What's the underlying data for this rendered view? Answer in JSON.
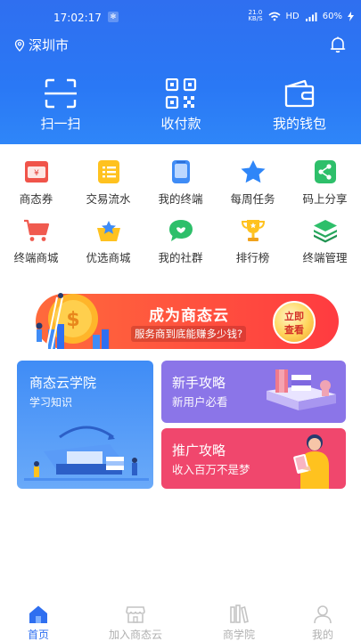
{
  "status_bar": {
    "time": "17:02:17",
    "speed_value": "21.0",
    "speed_unit": "KB/S",
    "network": "HD",
    "battery": "60%"
  },
  "header": {
    "city": "深圳市",
    "quick_actions": [
      {
        "label": "扫一扫",
        "icon": "scan-icon"
      },
      {
        "label": "收付款",
        "icon": "qrcode-icon"
      },
      {
        "label": "我的钱包",
        "icon": "wallet-icon"
      }
    ]
  },
  "features": [
    {
      "label": "商态券",
      "icon": "coupon-icon"
    },
    {
      "label": "交易流水",
      "icon": "list-icon"
    },
    {
      "label": "我的终端",
      "icon": "terminal-icon"
    },
    {
      "label": "每周任务",
      "icon": "star-icon"
    },
    {
      "label": "码上分享",
      "icon": "share-icon"
    },
    {
      "label": "终端商城",
      "icon": "cart-icon"
    },
    {
      "label": "优选商城",
      "icon": "basket-star-icon"
    },
    {
      "label": "我的社群",
      "icon": "chat-icon"
    },
    {
      "label": "排行榜",
      "icon": "trophy-icon"
    },
    {
      "label": "终端管理",
      "icon": "layers-icon"
    }
  ],
  "banner": {
    "title": "成为商态云",
    "subtitle": "服务商到底能赚多少钱?",
    "cta_line1": "立即",
    "cta_line2": "查看"
  },
  "cards": {
    "academy": {
      "title": "商态云学院",
      "subtitle": "学习知识"
    },
    "guide": {
      "title": "新手攻略",
      "subtitle": "新用户必看"
    },
    "promo": {
      "title": "推广攻略",
      "subtitle": "收入百万不是梦"
    }
  },
  "bottom_nav": [
    {
      "label": "首页",
      "icon": "home-icon",
      "active": true
    },
    {
      "label": "加入商态云",
      "icon": "store-icon",
      "active": false
    },
    {
      "label": "商学院",
      "icon": "books-icon",
      "active": false
    },
    {
      "label": "我的",
      "icon": "user-icon",
      "active": false
    }
  ],
  "colors": {
    "primary": "#2f6ff0",
    "banner": "#ff4a3e",
    "guide_card": "#8b75e8",
    "promo_card": "#f0476d"
  }
}
